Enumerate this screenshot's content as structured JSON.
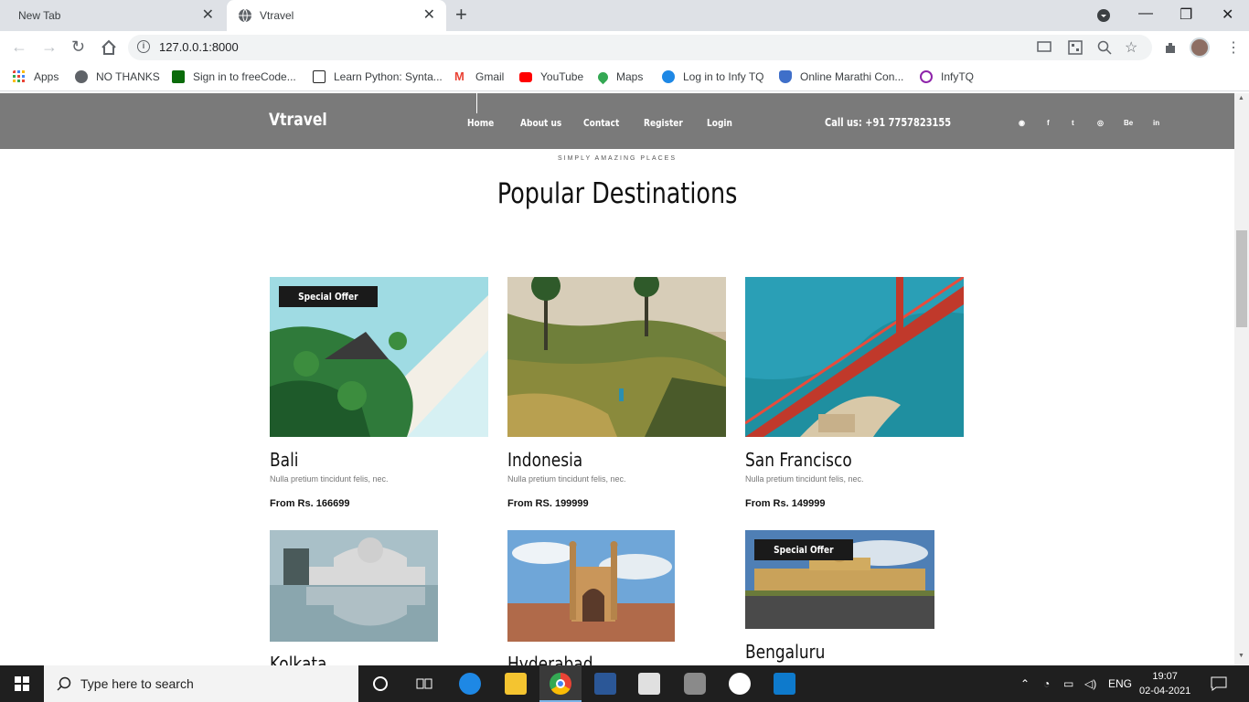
{
  "browser": {
    "tabs": [
      {
        "label": "New Tab",
        "active": false
      },
      {
        "label": "Vtravel",
        "active": true
      }
    ],
    "url": "127.0.0.1:8000",
    "bookmarks": [
      "Apps",
      "NO THANKS",
      "Sign in to freeCode...",
      "Learn Python: Synta...",
      "Gmail",
      "YouTube",
      "Maps",
      "Log in to Infy TQ",
      "Online Marathi Con...",
      "InfyTQ"
    ]
  },
  "site": {
    "brand": "Vtravel",
    "nav": [
      "Home",
      "About us",
      "Contact",
      "Register",
      "Login"
    ],
    "call": "Call us: +91 7757823155",
    "social_icons": [
      "dribbble-icon",
      "facebook-icon",
      "twitter-icon",
      "pinterest-icon",
      "behance-icon",
      "linkedin-icon"
    ],
    "social_glyphs": [
      "◉",
      "f",
      "t",
      "◎",
      "Be",
      "in"
    ]
  },
  "section": {
    "subtitle": "SIMPLY AMAZING PLACES",
    "title": "Popular Destinations"
  },
  "destinations": [
    {
      "name": "Bali",
      "desc": "Nulla pretium tincidunt felis, nec.",
      "price": "From Rs. 166699",
      "badge": "Special Offer"
    },
    {
      "name": "Indonesia",
      "desc": "Nulla pretium tincidunt felis, nec.",
      "price": "From RS. 199999",
      "badge": ""
    },
    {
      "name": "San Francisco",
      "desc": "Nulla pretium tincidunt felis, nec.",
      "price": "From Rs. 149999",
      "badge": ""
    },
    {
      "name": "Kolkata",
      "desc": "",
      "price": "",
      "badge": ""
    },
    {
      "name": "Hyderabad",
      "desc": "",
      "price": "",
      "badge": ""
    },
    {
      "name": "Bengaluru",
      "desc": "",
      "price": "",
      "badge": "Special Offer"
    }
  ],
  "taskbar": {
    "search_placeholder": "Type here to search",
    "lang": "ENG",
    "time": "19:07",
    "date": "02-04-2021"
  }
}
